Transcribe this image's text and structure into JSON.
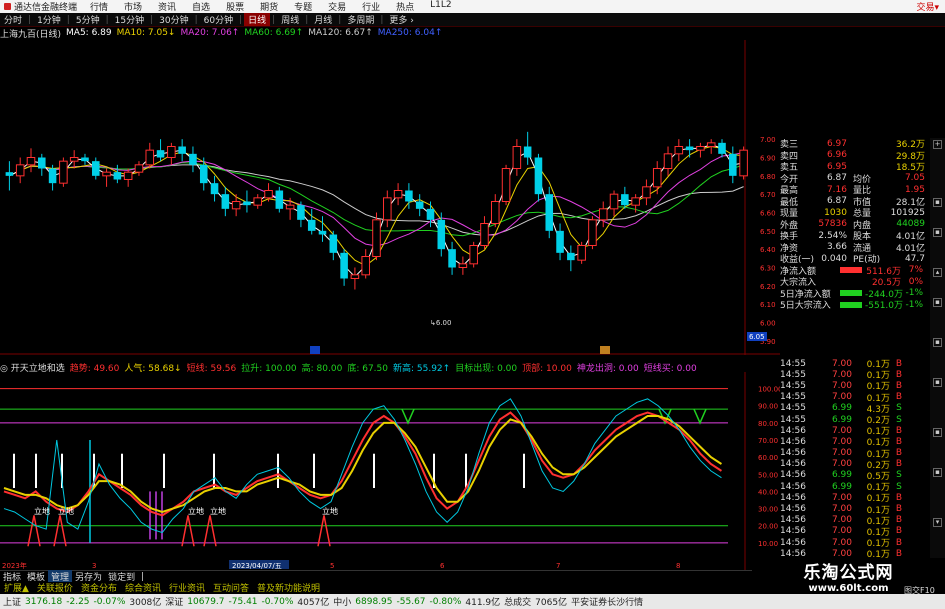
{
  "titlebar": {
    "app_name": "通达信金融终端",
    "menu": [
      "行情",
      "市场",
      "资讯",
      "自选",
      "股票",
      "期货",
      "专题",
      "交易",
      "行业",
      "热点",
      "L1L2"
    ],
    "right": "交易▾"
  },
  "periods": {
    "items": [
      "分时",
      "1分钟",
      "5分钟",
      "15分钟",
      "30分钟",
      "60分钟",
      "日线",
      "周线",
      "月线",
      "多周期",
      "更多 ›"
    ],
    "active": "日线"
  },
  "ma_bar": {
    "title": "上海九百(日线)",
    "items": [
      {
        "label": "MA5: 6.89",
        "color": "#ffffff"
      },
      {
        "label": "MA10: 7.05↓",
        "color": "#e8d000"
      },
      {
        "label": "MA20: 7.06↑",
        "color": "#e040e0"
      },
      {
        "label": "MA60: 6.69↑",
        "color": "#20d020"
      },
      {
        "label": "MA120: 6.67↑",
        "color": "#cccccc"
      },
      {
        "label": "MA250: 6.04↑",
        "color": "#4060ff"
      }
    ]
  },
  "indicator_bar": {
    "name": "◎ 开天立地和选",
    "items": [
      {
        "label": "趋势: 49.60",
        "color": "#ff3030"
      },
      {
        "label": "人气: 58.68↓",
        "color": "#e8d000"
      },
      {
        "label": "短线: 59.56",
        "color": "#ff3030"
      },
      {
        "label": "拉升: 100.00",
        "color": "#20d020"
      },
      {
        "label": "高: 80.00",
        "color": "#20d020"
      },
      {
        "label": "底: 67.50",
        "color": "#20d020"
      },
      {
        "label": "新高: 55.92↑",
        "color": "#00c8e0"
      },
      {
        "label": "目标出现: 0.00",
        "color": "#20d020"
      },
      {
        "label": "顶部: 10.00",
        "color": "#ff3030"
      },
      {
        "label": "神龙出洞: 0.00",
        "color": "#e040e0"
      },
      {
        "label": "短线买: 0.00",
        "color": "#e040e0"
      }
    ]
  },
  "quotes": [
    {
      "l": "卖三",
      "v": "6.97",
      "v_color": "#ff3030",
      "n": "",
      "q": "36.2万",
      "q_color": "#e8d000"
    },
    {
      "l": "卖四",
      "v": "6.96",
      "v_color": "#ff3030",
      "n": "",
      "q": "29.8万",
      "q_color": "#e8d000"
    },
    {
      "l": "卖五",
      "v": "6.95",
      "v_color": "#ff3030",
      "n": "",
      "q": "18.5万",
      "q_color": "#e8d000"
    },
    {
      "l": "今开",
      "v": "6.87",
      "v_color": "#dddddd",
      "n": "均价",
      "q": "7.05",
      "q_color": "#ff3030"
    },
    {
      "l": "最高",
      "v": "7.16",
      "v_color": "#ff3030",
      "n": "量比",
      "q": "1.95",
      "q_color": "#ff3030"
    },
    {
      "l": "最低",
      "v": "6.87",
      "v_color": "#dddddd",
      "n": "市值",
      "q": "28.1亿",
      "q_color": "#dddddd"
    },
    {
      "l": "现量",
      "v": "1030",
      "v_color": "#e8d000",
      "n": "总量",
      "q": "101925",
      "q_color": "#dddddd"
    },
    {
      "l": "外盘",
      "v": "57836",
      "v_color": "#ff3030",
      "n": "内盘",
      "q": "44089",
      "q_color": "#20d020"
    },
    {
      "l": "换手",
      "v": "2.54%",
      "v_color": "#dddddd",
      "n": "股本",
      "q": "4.01亿",
      "q_color": "#dddddd"
    },
    {
      "l": "净资",
      "v": "3.66",
      "v_color": "#dddddd",
      "n": "流通",
      "q": "4.01亿",
      "q_color": "#dddddd"
    },
    {
      "l": "收益(一)",
      "v": "0.040",
      "v_color": "#dddddd",
      "n": "PE(动)",
      "q": "47.7",
      "q_color": "#dddddd"
    }
  ],
  "flows": [
    {
      "l": "净流入额",
      "v": "511.6万",
      "v_color": "#ff3030",
      "p": "7%",
      "p_color": "#ff3030",
      "bar": "#ff3030"
    },
    {
      "l": "大宗流入",
      "v": "20.5万",
      "v_color": "#ff3030",
      "p": "0%",
      "p_color": "#ff3030",
      "bar": ""
    },
    {
      "l": "5日净流入额",
      "v": "-244.0万",
      "v_color": "#20d020",
      "p": "-1%",
      "p_color": "#20d020",
      "bar": "#20d020"
    },
    {
      "l": "5日大宗流入",
      "v": "-551.0万",
      "v_color": "#20d020",
      "p": "-1%",
      "p_color": "#20d020",
      "bar": "#20d020"
    }
  ],
  "ticks": [
    {
      "t": "14:55",
      "p": "7.00",
      "v": "0.1万",
      "s": "B"
    },
    {
      "t": "14:55",
      "p": "7.00",
      "v": "0.1万",
      "s": "B"
    },
    {
      "t": "14:55",
      "p": "7.00",
      "v": "0.1万",
      "s": "B"
    },
    {
      "t": "14:55",
      "p": "7.00",
      "v": "0.1万",
      "s": "B"
    },
    {
      "t": "14:55",
      "p": "6.99",
      "v": "4.3万",
      "s": "S"
    },
    {
      "t": "14:55",
      "p": "6.99",
      "v": "0.2万",
      "s": "S"
    },
    {
      "t": "14:56",
      "p": "7.00",
      "v": "0.1万",
      "s": "B"
    },
    {
      "t": "14:56",
      "p": "7.00",
      "v": "0.1万",
      "s": "B"
    },
    {
      "t": "14:56",
      "p": "7.00",
      "v": "0.1万",
      "s": "B"
    },
    {
      "t": "14:56",
      "p": "7.00",
      "v": "0.2万",
      "s": "B"
    },
    {
      "t": "14:56",
      "p": "6.99",
      "v": "0.5万",
      "s": "S"
    },
    {
      "t": "14:56",
      "p": "6.99",
      "v": "0.1万",
      "s": "S"
    },
    {
      "t": "14:56",
      "p": "7.00",
      "v": "0.1万",
      "s": "B"
    },
    {
      "t": "14:56",
      "p": "7.00",
      "v": "0.1万",
      "s": "B"
    },
    {
      "t": "14:56",
      "p": "7.00",
      "v": "0.1万",
      "s": "B"
    },
    {
      "t": "14:56",
      "p": "7.00",
      "v": "0.1万",
      "s": "B"
    },
    {
      "t": "14:56",
      "p": "7.00",
      "v": "0.1万",
      "s": "B"
    },
    {
      "t": "14:56",
      "p": "7.00",
      "v": "0.1万",
      "s": "B"
    },
    {
      "t": "14:56",
      "p": "6.99",
      "v": "0.1万",
      "s": "S"
    }
  ],
  "tabs": {
    "items": [
      "指标",
      "模板",
      "管理",
      "另存为",
      "锁定到",
      "|"
    ],
    "selected": "管理"
  },
  "tabs2": {
    "items": [
      "扩展▲",
      "关联报价",
      "资金分布",
      "综合资讯",
      "行业资讯",
      "互动问答",
      "普及新功能说明"
    ],
    "highlight": ""
  },
  "rside_label": "图交F10",
  "status": [
    {
      "t": "上证",
      "c": "#222222"
    },
    {
      "t": "3176.18",
      "c": "#008000"
    },
    {
      "t": "-2.25",
      "c": "#008000"
    },
    {
      "t": "-0.07%",
      "c": "#008000"
    },
    {
      "t": "3008亿",
      "c": "#222222"
    },
    {
      "t": "深证",
      "c": "#222222"
    },
    {
      "t": "10679.7",
      "c": "#008000"
    },
    {
      "t": "-75.41",
      "c": "#008000"
    },
    {
      "t": "-0.70%",
      "c": "#008000"
    },
    {
      "t": "4057亿",
      "c": "#222222"
    },
    {
      "t": "中小",
      "c": "#222222"
    },
    {
      "t": "6898.95",
      "c": "#008000"
    },
    {
      "t": "-55.67",
      "c": "#008000"
    },
    {
      "t": "-0.80%",
      "c": "#008000"
    },
    {
      "t": "411.9亿",
      "c": "#222222"
    },
    {
      "t": "总成交",
      "c": "#222222"
    },
    {
      "t": "7065亿",
      "c": "#222222"
    },
    {
      "t": "平安证券长沙行情",
      "c": "#222222"
    }
  ],
  "watermark": {
    "title": "乐淘公式网",
    "url": "www.60lt.com"
  },
  "chart_data": [
    {
      "type": "candlestick",
      "y_ticks": [
        "7.00",
        "6.90",
        "6.80",
        "6.70",
        "6.60",
        "6.50",
        "6.40",
        "6.30",
        "6.20",
        "6.10",
        "6.00",
        "5.90"
      ],
      "ylim": [
        5.85,
        7.05
      ],
      "current_price_label": "6.05",
      "low_label": "6.00",
      "highlight_price_label": "7.16",
      "candles": [
        [
          6.82,
          6.88,
          6.72,
          6.8
        ],
        [
          6.8,
          6.9,
          6.76,
          6.86
        ],
        [
          6.86,
          6.95,
          6.82,
          6.9
        ],
        [
          6.9,
          6.92,
          6.8,
          6.84
        ],
        [
          6.84,
          6.86,
          6.72,
          6.76
        ],
        [
          6.76,
          6.9,
          6.74,
          6.88
        ],
        [
          6.88,
          6.94,
          6.84,
          6.9
        ],
        [
          6.9,
          6.92,
          6.86,
          6.88
        ],
        [
          6.88,
          6.9,
          6.78,
          6.8
        ],
        [
          6.8,
          6.84,
          6.74,
          6.82
        ],
        [
          6.82,
          6.86,
          6.76,
          6.78
        ],
        [
          6.78,
          6.84,
          6.74,
          6.82
        ],
        [
          6.82,
          6.88,
          6.8,
          6.86
        ],
        [
          6.86,
          6.98,
          6.84,
          6.94
        ],
        [
          6.94,
          7.0,
          6.88,
          6.9
        ],
        [
          6.9,
          6.98,
          6.86,
          6.96
        ],
        [
          6.96,
          7.0,
          6.88,
          6.92
        ],
        [
          6.92,
          6.96,
          6.82,
          6.86
        ],
        [
          6.86,
          6.9,
          6.72,
          6.76
        ],
        [
          6.76,
          6.8,
          6.66,
          6.7
        ],
        [
          6.7,
          6.74,
          6.58,
          6.62
        ],
        [
          6.62,
          6.7,
          6.58,
          6.66
        ],
        [
          6.66,
          6.72,
          6.6,
          6.64
        ],
        [
          6.64,
          6.7,
          6.62,
          6.68
        ],
        [
          6.68,
          6.76,
          6.66,
          6.72
        ],
        [
          6.72,
          6.74,
          6.6,
          6.62
        ],
        [
          6.62,
          6.68,
          6.56,
          6.64
        ],
        [
          6.64,
          6.66,
          6.52,
          6.56
        ],
        [
          6.56,
          6.62,
          6.48,
          6.5
        ],
        [
          6.5,
          6.58,
          6.44,
          6.48
        ],
        [
          6.48,
          6.5,
          6.34,
          6.38
        ],
        [
          6.38,
          6.4,
          6.2,
          6.24
        ],
        [
          6.24,
          6.3,
          6.18,
          6.26
        ],
        [
          6.26,
          6.4,
          6.24,
          6.36
        ],
        [
          6.36,
          6.6,
          6.34,
          6.56
        ],
        [
          6.56,
          6.72,
          6.52,
          6.68
        ],
        [
          6.68,
          6.76,
          6.64,
          6.72
        ],
        [
          6.72,
          6.76,
          6.62,
          6.66
        ],
        [
          6.66,
          6.7,
          6.58,
          6.62
        ],
        [
          6.62,
          6.66,
          6.52,
          6.56
        ],
        [
          6.56,
          6.6,
          6.36,
          6.4
        ],
        [
          6.4,
          6.44,
          6.26,
          6.3
        ],
        [
          6.3,
          6.36,
          6.26,
          6.32
        ],
        [
          6.32,
          6.44,
          6.3,
          6.42
        ],
        [
          6.42,
          6.58,
          6.4,
          6.54
        ],
        [
          6.54,
          6.7,
          6.52,
          6.66
        ],
        [
          6.66,
          6.86,
          6.64,
          6.84
        ],
        [
          6.84,
          7.0,
          6.8,
          6.96
        ],
        [
          6.96,
          7.04,
          6.86,
          6.9
        ],
        [
          6.9,
          6.92,
          6.66,
          6.7
        ],
        [
          6.7,
          6.74,
          6.46,
          6.5
        ],
        [
          6.5,
          6.54,
          6.34,
          6.38
        ],
        [
          6.38,
          6.42,
          6.28,
          6.34
        ],
        [
          6.34,
          6.44,
          6.32,
          6.42
        ],
        [
          6.42,
          6.58,
          6.4,
          6.56
        ],
        [
          6.56,
          6.66,
          6.52,
          6.62
        ],
        [
          6.62,
          6.72,
          6.58,
          6.7
        ],
        [
          6.7,
          6.74,
          6.62,
          6.64
        ],
        [
          6.64,
          6.7,
          6.6,
          6.68
        ],
        [
          6.68,
          6.78,
          6.64,
          6.74
        ],
        [
          6.74,
          6.88,
          6.7,
          6.84
        ],
        [
          6.84,
          6.96,
          6.8,
          6.92
        ],
        [
          6.92,
          7.0,
          6.88,
          6.96
        ],
        [
          6.96,
          7.0,
          6.9,
          6.94
        ],
        [
          6.94,
          6.98,
          6.9,
          6.96
        ],
        [
          6.96,
          7.0,
          6.92,
          6.98
        ],
        [
          6.98,
          7.0,
          6.9,
          6.92
        ],
        [
          6.92,
          6.96,
          6.76,
          6.8
        ],
        [
          6.8,
          6.96,
          6.78,
          6.94
        ]
      ]
    },
    {
      "type": "line",
      "y_ticks": [
        "100.00",
        "90.00",
        "80.00",
        "70.00",
        "60.00",
        "50.00",
        "40.00",
        "30.00",
        "20.00",
        "10.00"
      ],
      "ylim": [
        0,
        105
      ],
      "x_labels": [
        "2023年",
        "3",
        "2023/04/07/五",
        "5",
        "6",
        "7",
        "8"
      ],
      "hlines": [
        {
          "value": 100,
          "color": "#ff3030"
        },
        {
          "value": 88,
          "color": "#20d020"
        },
        {
          "value": 80,
          "color": "#e040e0"
        },
        {
          "value": 20,
          "color": "#20d020"
        },
        {
          "value": 10,
          "color": "#e040e0"
        }
      ],
      "annotations": [
        "立地",
        "立地",
        "立地",
        "立地",
        "立地",
        "立地"
      ],
      "series": [
        {
          "color": "#ff3030",
          "values": [
            40,
            38,
            36,
            40,
            34,
            30,
            28,
            32,
            40,
            50,
            46,
            42,
            38,
            32,
            28,
            26,
            30,
            34,
            40,
            42,
            44,
            40,
            38,
            42,
            46,
            48,
            50,
            46,
            42,
            38,
            36,
            38,
            46,
            58,
            70,
            80,
            84,
            80,
            72,
            62,
            48,
            36,
            30,
            34,
            44,
            58,
            72,
            82,
            86,
            80,
            70,
            58,
            50,
            48,
            50,
            56,
            64,
            70,
            76,
            80,
            84,
            86,
            84,
            80,
            76,
            70,
            62,
            56,
            52
          ]
        },
        {
          "color": "#e8d000",
          "values": [
            42,
            40,
            38,
            38,
            36,
            32,
            30,
            32,
            38,
            46,
            46,
            44,
            40,
            34,
            30,
            28,
            30,
            32,
            36,
            40,
            42,
            42,
            40,
            40,
            44,
            46,
            48,
            46,
            44,
            40,
            38,
            38,
            42,
            52,
            64,
            74,
            80,
            80,
            74,
            66,
            54,
            42,
            34,
            34,
            40,
            52,
            66,
            76,
            82,
            80,
            72,
            62,
            54,
            50,
            50,
            54,
            60,
            66,
            72,
            76,
            80,
            84,
            84,
            82,
            78,
            72,
            66,
            60,
            56
          ]
        },
        {
          "color": "#00c8e0",
          "values": [
            30,
            28,
            24,
            20,
            18,
            70,
            22,
            18,
            34,
            56,
            44,
            36,
            30,
            22,
            18,
            16,
            24,
            30,
            40,
            44,
            48,
            40,
            36,
            44,
            50,
            52,
            54,
            48,
            40,
            34,
            30,
            34,
            50,
            66,
            80,
            88,
            90,
            82,
            70,
            56,
            40,
            28,
            22,
            28,
            42,
            62,
            80,
            90,
            94,
            84,
            68,
            52,
            42,
            40,
            46,
            56,
            68,
            76,
            84,
            88,
            92,
            94,
            90,
            84,
            76,
            66,
            58,
            52,
            48
          ]
        }
      ]
    }
  ]
}
